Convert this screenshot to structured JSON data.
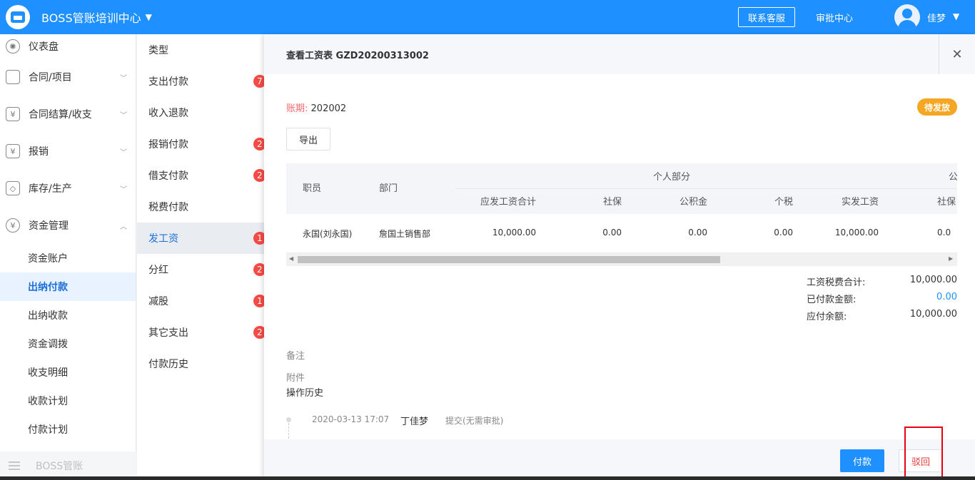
{
  "header": {
    "app_title": "BOSS管账培训中心",
    "support_label": "联系客服",
    "approval_label": "审批中心",
    "username": "佳梦",
    "accent_color": "#1e90ff"
  },
  "sidebar": {
    "items": [
      {
        "label": "仪表盘",
        "icon": "dashboard-icon"
      },
      {
        "label": "合同/项目",
        "icon": "folder-icon"
      },
      {
        "label": "合同结算/收支",
        "icon": "settlement-icon"
      },
      {
        "label": "报销",
        "icon": "reimburse-icon"
      },
      {
        "label": "库存/生产",
        "icon": "box-icon"
      },
      {
        "label": "资金管理",
        "icon": "fund-icon"
      }
    ],
    "sub_items": [
      "资金账户",
      "出纳付款",
      "出纳收款",
      "资金调拨",
      "收支明细",
      "收款计划",
      "付款计划"
    ],
    "footer_label": "BOSS管账"
  },
  "midlist": {
    "header": "类型",
    "items": [
      {
        "label": "支出付款",
        "badge": "7"
      },
      {
        "label": "收入退款",
        "badge": ""
      },
      {
        "label": "报销付款",
        "badge": "2"
      },
      {
        "label": "借支付款",
        "badge": "2"
      },
      {
        "label": "税费付款",
        "badge": ""
      },
      {
        "label": "发工资",
        "badge": "1"
      },
      {
        "label": "分红",
        "badge": "2"
      },
      {
        "label": "减股",
        "badge": "1"
      },
      {
        "label": "其它支出",
        "badge": "2"
      },
      {
        "label": "付款历史",
        "badge": ""
      }
    ]
  },
  "panel": {
    "title": "查看工资表 GZD20200313002",
    "period_label": "账期:",
    "period_value": "202002",
    "status": "待发放",
    "export_label": "导出",
    "table": {
      "group_header": "个人部分",
      "group_header_2": "公",
      "col_employee": "职员",
      "col_department": "部门",
      "sub_columns": [
        "应发工资合计",
        "社保",
        "公积金",
        "个税",
        "实发工资",
        "社保"
      ],
      "rows": [
        {
          "employee": "永国(刘永国)",
          "department": "詹国土销售部",
          "gross": "10,000.00",
          "social": "0.00",
          "fund": "0.00",
          "tax": "0.00",
          "net": "10,000.00",
          "social2": "0.0"
        }
      ]
    },
    "totals": {
      "total_label": "工资税费合计:",
      "total_value": "10,000.00",
      "paid_label": "已付款金额:",
      "paid_value": "0.00",
      "due_label": "应付余额:",
      "due_value": "10,000.00"
    },
    "remarks_label": "备注",
    "attach_label": "附件",
    "history_title": "操作历史",
    "history": [
      {
        "time": "2020-03-13 17:07",
        "user": "丁佳梦",
        "action": "提交(无需审批)"
      }
    ],
    "pay_label": "付款",
    "reject_label": "驳回"
  }
}
